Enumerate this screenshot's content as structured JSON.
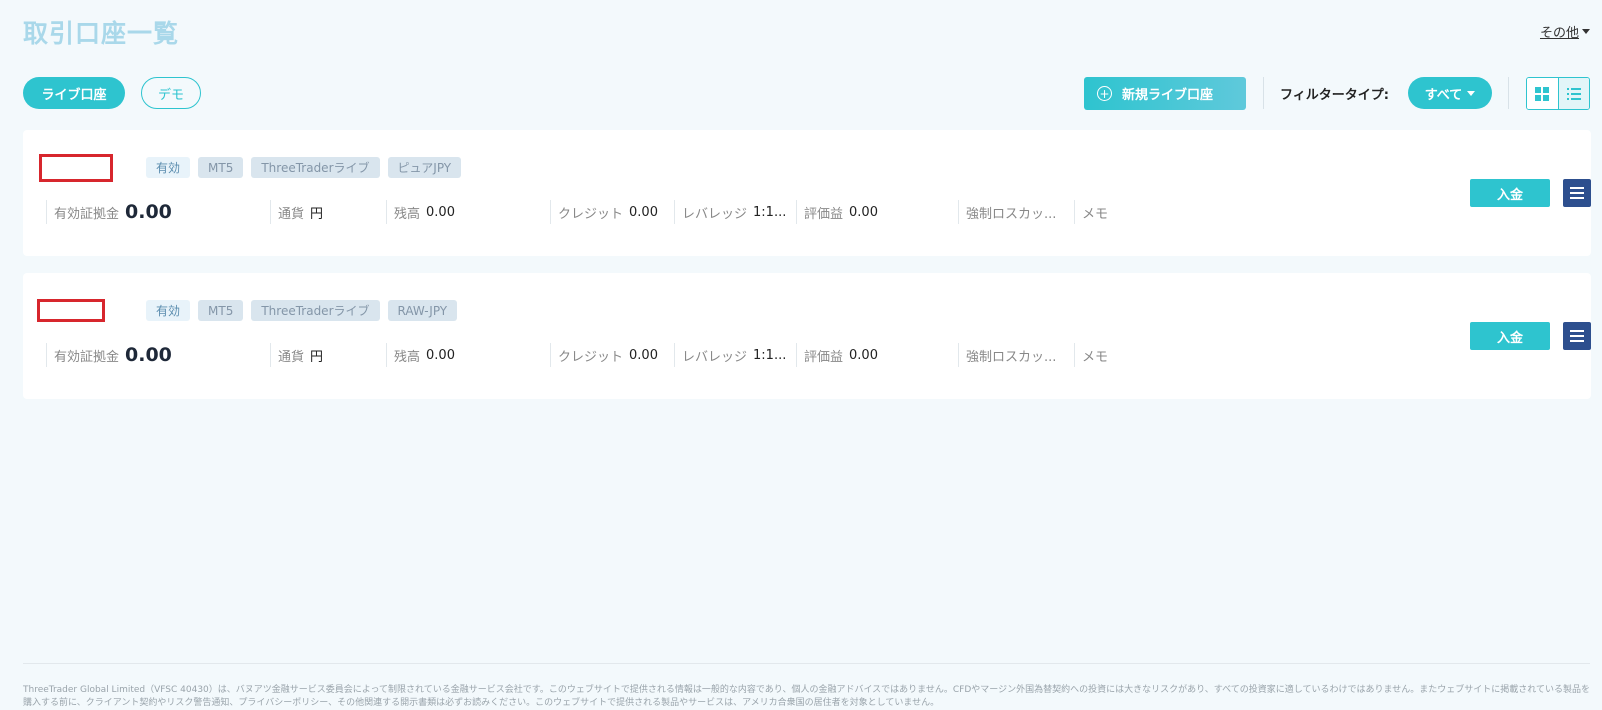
{
  "header": {
    "title": "取引口座一覧",
    "other_menu": "その他"
  },
  "tabs": {
    "live": "ライブ口座",
    "demo": "デモ"
  },
  "toolbar": {
    "new_live_account": "新規ライブ口座",
    "filter_label": "フィルタータイプ:",
    "filter_value": "すべて"
  },
  "accounts": [
    {
      "status": "有効",
      "platform": "MT5",
      "account_type": "ThreeTraderライブ",
      "variant": "ピュアJPY",
      "equity_label": "有効証拠金",
      "equity": "0.00",
      "currency_label": "通貨",
      "currency": "円",
      "balance_label": "残高",
      "balance": "0.00",
      "credit_label": "クレジット",
      "credit": "0.00",
      "leverage_label": "レバレッジ",
      "leverage": "1:1...",
      "pnl_label": "評価益",
      "pnl": "0.00",
      "stopout_label": "強制ロスカッ...",
      "memo_label": "メモ",
      "deposit": "入金"
    },
    {
      "status": "有効",
      "platform": "MT5",
      "account_type": "ThreeTraderライブ",
      "variant": "RAW-JPY",
      "equity_label": "有効証拠金",
      "equity": "0.00",
      "currency_label": "通貨",
      "currency": "円",
      "balance_label": "残高",
      "balance": "0.00",
      "credit_label": "クレジット",
      "credit": "0.00",
      "leverage_label": "レバレッジ",
      "leverage": "1:1...",
      "pnl_label": "評価益",
      "pnl": "0.00",
      "stopout_label": "強制ロスカッ...",
      "memo_label": "メモ",
      "deposit": "入金"
    }
  ],
  "footer": {
    "disclaimer": "ThreeTrader Global Limited（VFSC 40430）は、バヌアツ金融サービス委員会によって制限されている金融サービス会社です。このウェブサイトで提供される情報は一般的な内容であり、個人の金融アドバイスではありません。CFDやマージン外国為替契約への投資には大きなリスクがあり、すべての投資家に適しているわけではありません。またウェブサイトに掲載されている製品を購入する前に、クライアント契約やリスク警告通知、プライバシーポリシー、その他関連する開示書類は必ずお読みください。このウェブサイトで提供される製品やサービスは、アメリカ合衆国の居住者を対象としていません。"
  },
  "colors": {
    "accent": "#2ec4cf",
    "title": "#a9d8ea",
    "menu_button": "#2d4f8e",
    "redaction": "#d7262d"
  }
}
